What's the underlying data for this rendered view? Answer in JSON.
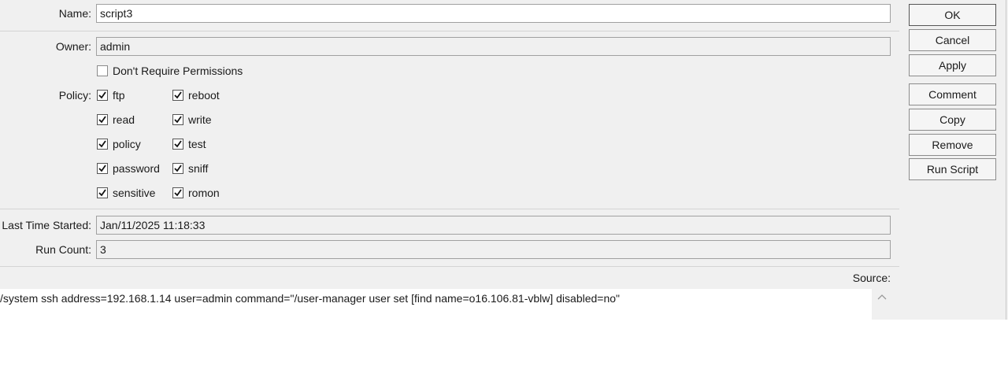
{
  "form": {
    "name": {
      "label": "Name:",
      "value": "script3"
    },
    "owner": {
      "label": "Owner:",
      "value": "admin"
    },
    "dont_require_permissions": {
      "label": "Don't Require Permissions",
      "checked": false
    },
    "policy": {
      "label": "Policy:",
      "options": [
        {
          "label": "ftp",
          "checked": true
        },
        {
          "label": "reboot",
          "checked": true
        },
        {
          "label": "read",
          "checked": true
        },
        {
          "label": "write",
          "checked": true
        },
        {
          "label": "policy",
          "checked": true
        },
        {
          "label": "test",
          "checked": true
        },
        {
          "label": "password",
          "checked": true
        },
        {
          "label": "sniff",
          "checked": true
        },
        {
          "label": "sensitive",
          "checked": true
        },
        {
          "label": "romon",
          "checked": true
        }
      ]
    },
    "last_time_started": {
      "label": "Last Time Started:",
      "value": "Jan/11/2025 11:18:33"
    },
    "run_count": {
      "label": "Run Count:",
      "value": "3"
    },
    "source": {
      "label": "Source:",
      "value": "/system ssh address=192.168.1.14 user=admin command=\"/user-manager user set [find name=o16.106.81-vblw] disabled=no\""
    }
  },
  "buttons": {
    "ok": "OK",
    "cancel": "Cancel",
    "apply": "Apply",
    "comment": "Comment",
    "copy": "Copy",
    "remove": "Remove",
    "run_script": "Run Script"
  },
  "icons": {
    "checkmark": "check-icon",
    "scroll_up": "chevron-up-icon"
  }
}
